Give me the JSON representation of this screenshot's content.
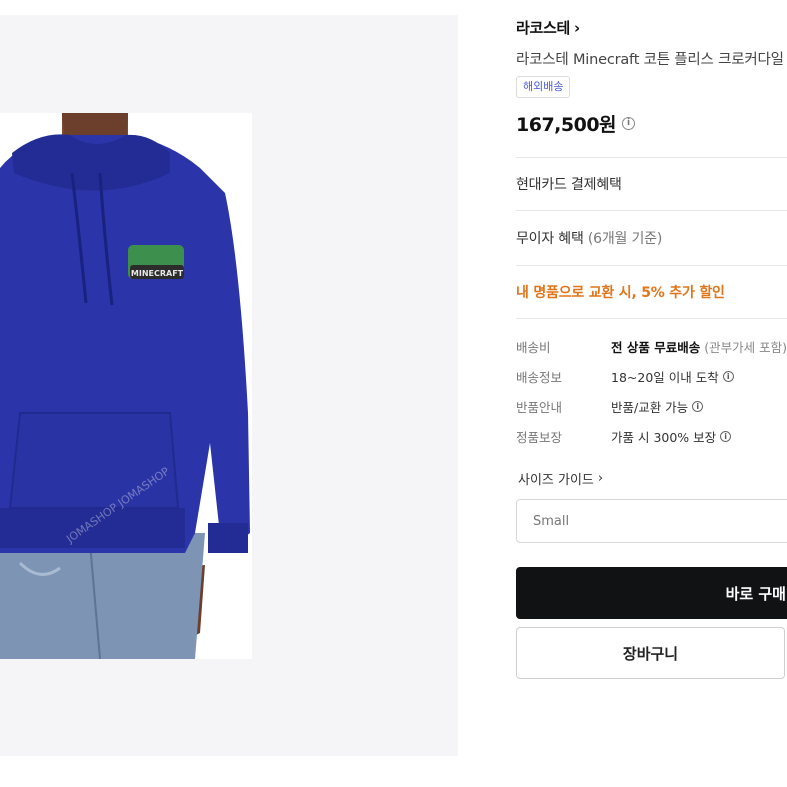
{
  "product": {
    "brand": "라코스테",
    "title": "라코스테 Minecraft 코튼 플리스 크로커다일",
    "badge": "해외배송",
    "price": "167,500원",
    "image_watermark": "JOMASHOP"
  },
  "benefits": {
    "card": "현대카드 결제혜택",
    "installment_main": "무이자 혜택 ",
    "installment_sub": "(6개월 기준)",
    "promo": "내 명품으로 교환 시, 5% 추가 할인"
  },
  "shipping": {
    "rows": [
      {
        "label": "배송비",
        "value_bold": "전 상품 무료배송",
        "value_extra": " (관부가세 포함)"
      },
      {
        "label": "배송정보",
        "value": "18~20일 이내 도착"
      },
      {
        "label": "반품안내",
        "value": "반품/교환 가능"
      },
      {
        "label": "정품보장",
        "value": "가품 시 300% 보장"
      }
    ]
  },
  "size": {
    "guide_label": "사이즈 가이드",
    "selected": "Small"
  },
  "actions": {
    "buy_label": "바로 구매",
    "cart_label": "장바구니"
  },
  "colors": {
    "promo": "#e0751b",
    "badge_text": "#4a5bd4",
    "buy_button": "#111214",
    "hoodie": "#2b34a8"
  }
}
